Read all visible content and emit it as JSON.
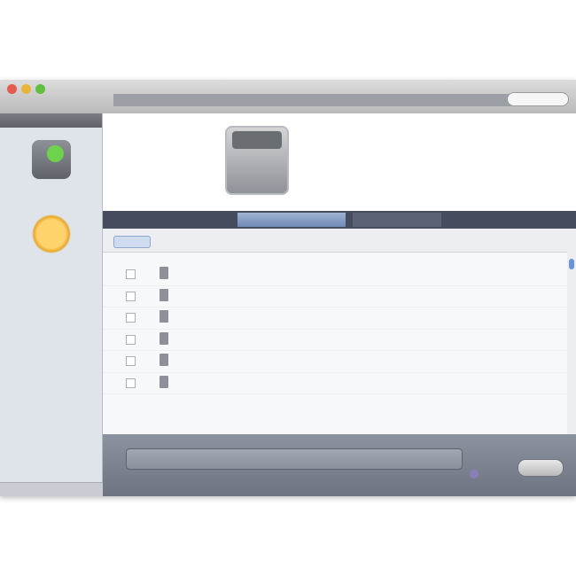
{
  "window": {
    "title": "",
    "search_placeholder": ""
  },
  "sidebar": {
    "header": "",
    "devices": [
      {
        "label": "",
        "icon": "device-sync-icon",
        "color": "#5fbf3f"
      },
      {
        "label": "",
        "icon": "folder-icon",
        "color": "#f0b93c"
      }
    ]
  },
  "summary": {
    "caption": "",
    "info": [
      "",
      "",
      "",
      ""
    ]
  },
  "tabs": [
    {
      "label": ""
    },
    {
      "label": ""
    },
    {
      "label": ""
    },
    {
      "label": ""
    }
  ],
  "list": {
    "select_all": "",
    "col_name": "",
    "col_right": "",
    "rows": [
      {
        "name": "",
        "desc": "",
        "status": ""
      },
      {
        "name": "",
        "desc": "",
        "status": ""
      },
      {
        "name": "",
        "desc": "",
        "status": ""
      },
      {
        "name": "",
        "desc": "",
        "status": ""
      },
      {
        "name": "",
        "desc": "",
        "status": ""
      },
      {
        "name": "",
        "desc": "",
        "status": ""
      }
    ],
    "footer": ""
  },
  "bottom": {
    "capacity_text": "",
    "sync_label": ""
  },
  "colors": {
    "sidebar_bg": "#dfe3ea",
    "tab_bar": "#454c5e",
    "tab_active": "#7c96c2",
    "bottom_bar": "#7b818e"
  }
}
